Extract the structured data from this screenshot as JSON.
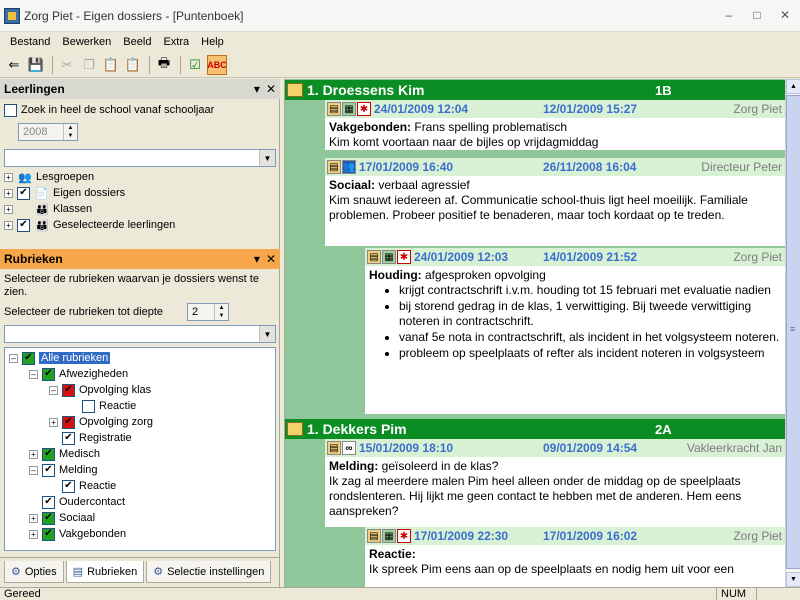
{
  "window": {
    "title": "Zorg Piet - Eigen dossiers - [Puntenboek]",
    "minimize": "–",
    "maximize": "□",
    "close": "✕"
  },
  "menu": [
    "Bestand",
    "Bewerken",
    "Beeld",
    "Extra",
    "Help"
  ],
  "leerlingen": {
    "title": "Leerlingen",
    "search_all_label": "Zoek in heel de school vanaf schooljaar",
    "year": "2008",
    "tree": [
      {
        "label": "Lesgroepen",
        "checked": false
      },
      {
        "label": "Eigen dossiers",
        "checked": true
      },
      {
        "label": "Klassen",
        "checked": false
      },
      {
        "label": "Geselecteerde leerlingen",
        "checked": true
      }
    ]
  },
  "rubrieken": {
    "title": "Rubrieken",
    "instruction": "Selecteer de rubrieken waarvan je dossiers wenst te zien.",
    "depth_label": "Selecteer de rubrieken tot diepte",
    "depth": "2",
    "tree": {
      "root": "Alle rubrieken",
      "afwezigheden": "Afwezigheden",
      "opvolging_klas": "Opvolging klas",
      "reactie1": "Reactie",
      "opvolging_zorg": "Opvolging zorg",
      "registratie": "Registratie",
      "medisch": "Medisch",
      "melding": "Melding",
      "reactie2": "Reactie",
      "oudercontact": "Oudercontact",
      "sociaal": "Sociaal",
      "vakgebonden": "Vakgebonden"
    }
  },
  "tabs": [
    "Opties",
    "Rubrieken",
    "Selectie instellingen"
  ],
  "students": [
    {
      "name": "1. Droessens Kim",
      "class": "1B",
      "entries": [
        {
          "date1": "24/01/2009 12:04",
          "date2": "12/01/2009 15:27",
          "author": "Zorg Piet",
          "cat": "Vakgebonden:",
          "subject": "Frans spelling problematisch",
          "text": "Kim komt voortaan naar de bijles op vrijdagmiddag"
        },
        {
          "date1": "17/01/2009 16:40",
          "date2": "26/11/2008 16:04",
          "author": "Directeur Peter",
          "cat": "Sociaal:",
          "subject": "verbaal agressief",
          "text": "Kim snauwt iedereen af. Communicatie school-thuis ligt heel moeilijk. Familiale problemen. Probeer positief te benaderen, maar toch kordaat op te treden."
        },
        {
          "date1": "24/01/2009 12:03",
          "date2": "14/01/2009 21:52",
          "author": "Zorg Piet",
          "cat": "Houding:",
          "subject": "afgesproken opvolging",
          "bullets": [
            "krijgt contractschrift i.v.m. houding tot 15 februari met evaluatie nadien",
            "bij storend gedrag in de klas, 1 verwittiging. Bij tweede verwittiging noteren in contractschrift.",
            "vanaf 5e nota in contractschrift, als incident in het volgsysteem noteren.",
            "probleem op speelplaats of refter als incident noteren in volgsysteem"
          ]
        }
      ]
    },
    {
      "name": "1. Dekkers Pim",
      "class": "2A",
      "entries": [
        {
          "date1": "15/01/2009 18:10",
          "date2": "09/01/2009 14:54",
          "author": "Vakleerkracht Jan",
          "cat": "Melding:",
          "subject": "geïsoleerd in de klas?",
          "text": "Ik zag al meerdere malen Pim heel alleen onder de middag op de speelplaats rondslenteren. Hij lijkt me geen contact te hebben met de anderen. Hem eens aanspreken?"
        },
        {
          "date1": "17/01/2009 22:30",
          "date2": "17/01/2009 16:02",
          "author": "Zorg Piet",
          "cat": "Reactie:",
          "subject": "",
          "text": "Ik spreek Pim eens aan op de speelplaats en nodig hem uit voor een"
        }
      ]
    }
  ],
  "status": {
    "text": "Gereed",
    "num": "NUM"
  }
}
